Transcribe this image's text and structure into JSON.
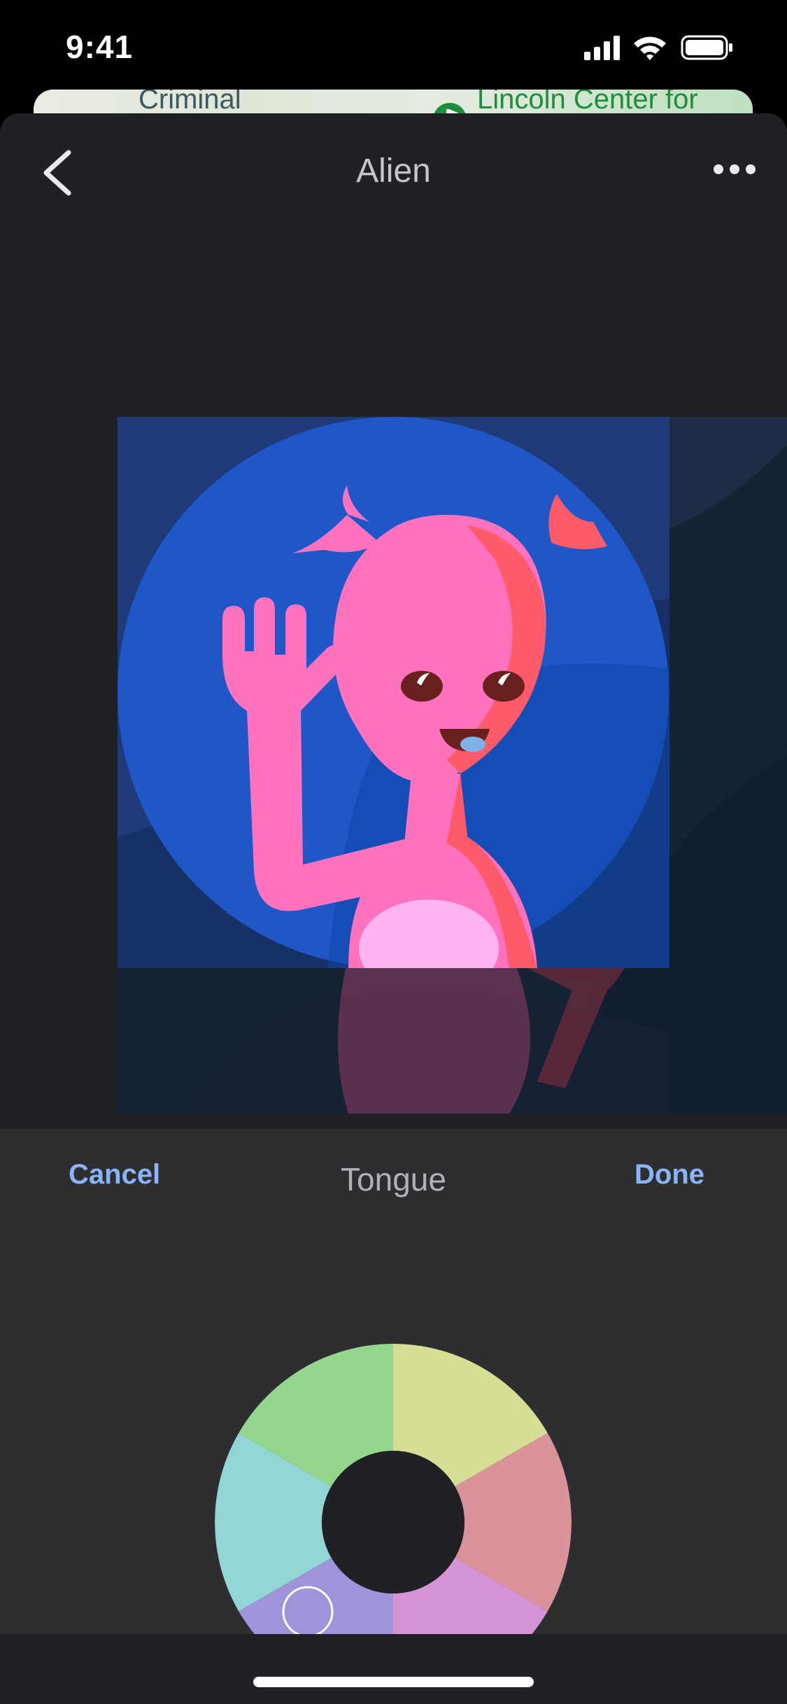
{
  "status_bar": {
    "time": "9:41",
    "icons": [
      "cellular-signal-icon",
      "wifi-icon",
      "battery-icon"
    ]
  },
  "map_peek": {
    "left_label": "Criminal",
    "right_label": "Lincoln Center for"
  },
  "header": {
    "title": "Alien",
    "back_icon": "chevron-left-icon",
    "more_icon": "more-horizontal-icon"
  },
  "editor": {
    "cancel_label": "Cancel",
    "part_label": "Tongue",
    "done_label": "Done"
  },
  "colors": {
    "accent": "#8ab4f8",
    "sheet_bg": "#202124",
    "panel_bg": "#2d2e30",
    "alien_pink": "#ff72bd",
    "alien_shadow": "#ff5a6a",
    "moon_blue": "#1f57c9",
    "tongue": "#7db3e8"
  },
  "color_wheel": {
    "selected_hue_degrees": 225
  }
}
